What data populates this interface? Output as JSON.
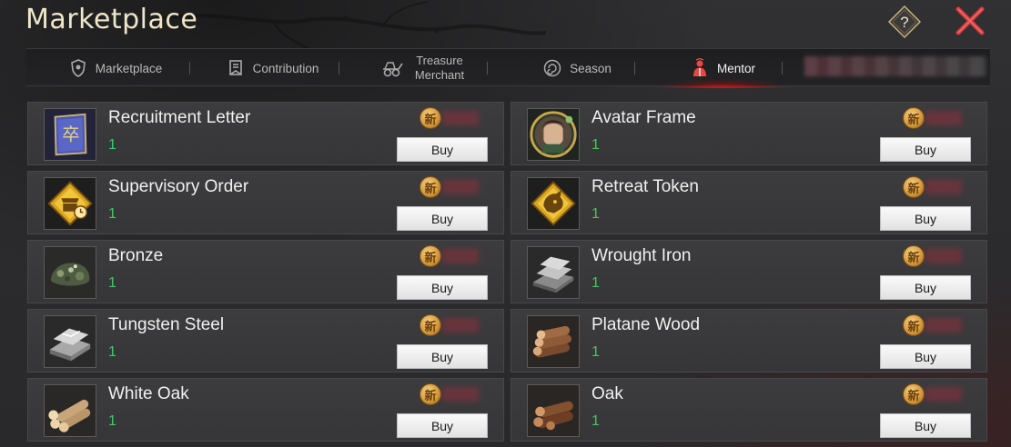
{
  "window": {
    "title": "Marketplace",
    "help_label": "?"
  },
  "tabs": [
    {
      "label": "Marketplace",
      "icon": "shield-tab-icon",
      "active": false
    },
    {
      "label": "Contribution",
      "icon": "banner-tab-icon",
      "active": false
    },
    {
      "label": "Treasure",
      "label2": "Merchant",
      "icon": "cart-tab-icon",
      "active": false
    },
    {
      "label": "Season",
      "icon": "spiral-tab-icon",
      "active": false
    },
    {
      "label": "Mentor",
      "icon": "mentor-tab-icon",
      "active": true
    }
  ],
  "currency_glyph": "新",
  "buy_label": "Buy",
  "items": [
    {
      "name": "Recruitment Letter",
      "qty": "1",
      "icon": "letter-item-icon"
    },
    {
      "name": "Avatar Frame",
      "qty": "1",
      "icon": "avatar-frame-item-icon"
    },
    {
      "name": "Supervisory Order",
      "qty": "1",
      "icon": "order-item-icon"
    },
    {
      "name": "Retreat Token",
      "qty": "1",
      "icon": "token-item-icon"
    },
    {
      "name": "Bronze",
      "qty": "1",
      "icon": "bronze-item-icon"
    },
    {
      "name": "Wrought Iron",
      "qty": "1",
      "icon": "iron-item-icon"
    },
    {
      "name": "Tungsten Steel",
      "qty": "1",
      "icon": "steel-item-icon"
    },
    {
      "name": "Platane Wood",
      "qty": "1",
      "icon": "platane-item-icon"
    },
    {
      "name": "White Oak",
      "qty": "1",
      "icon": "white-oak-item-icon"
    },
    {
      "name": "Oak",
      "qty": "1",
      "icon": "oak-item-icon"
    }
  ],
  "colors": {
    "accent_red": "#c21a1a",
    "quantity_green": "#3ecb63",
    "title_cream": "#efe6c8"
  }
}
